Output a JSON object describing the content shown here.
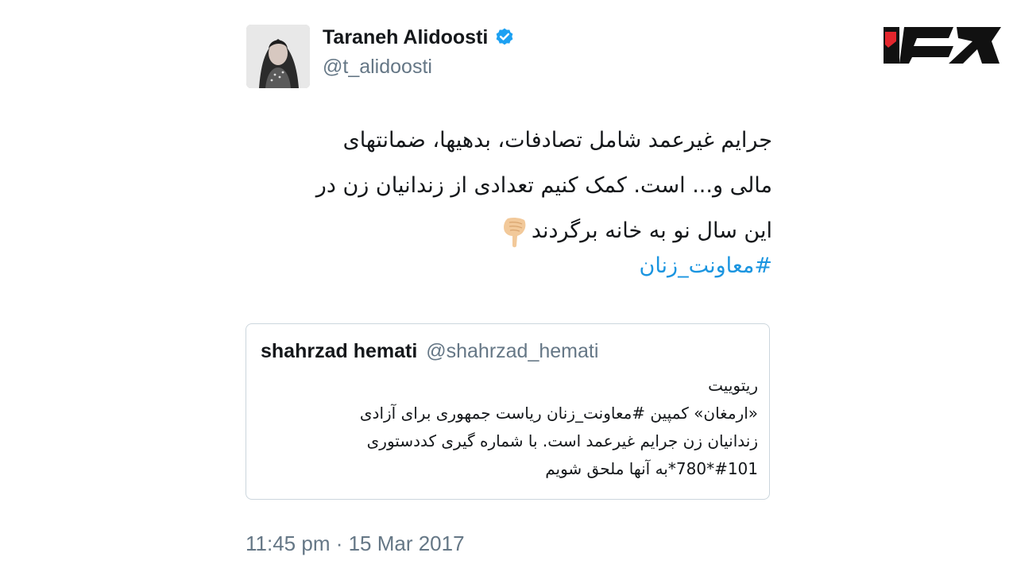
{
  "author": {
    "name": "Taraneh Alidoosti",
    "handle": "@t_alidoosti"
  },
  "tweet": {
    "lines": [
      "جرایم غیرعمد شامل تصادفات، بدهیها، ضمانتهای",
      "مالی و... است. کمک کنیم تعدادی از زندانیان زن در",
      "این سال نو به خانه برگردند"
    ],
    "emoji": "pointing-down-hand-icon",
    "hashtag": "#معاونت_زنان"
  },
  "quote": {
    "name": "shahrzad hemati",
    "handle": "@shahrzad_hemati",
    "lines": [
      "ریتوییت",
      "«ارمغان» کمپین #معاونت_زنان ریاست جمهوری برای آزادی",
      "زندانیان زن جرایم غیرعمد است. با شماره گیری کددستوری",
      "#101*780*به آنها ملحق شویم"
    ]
  },
  "timestamp": "11:45 pm · 15 Mar 2017",
  "colors": {
    "accent": "#1b95e0",
    "muted": "#657786",
    "border": "#ccd6dd",
    "logo_red": "#e3262d"
  }
}
